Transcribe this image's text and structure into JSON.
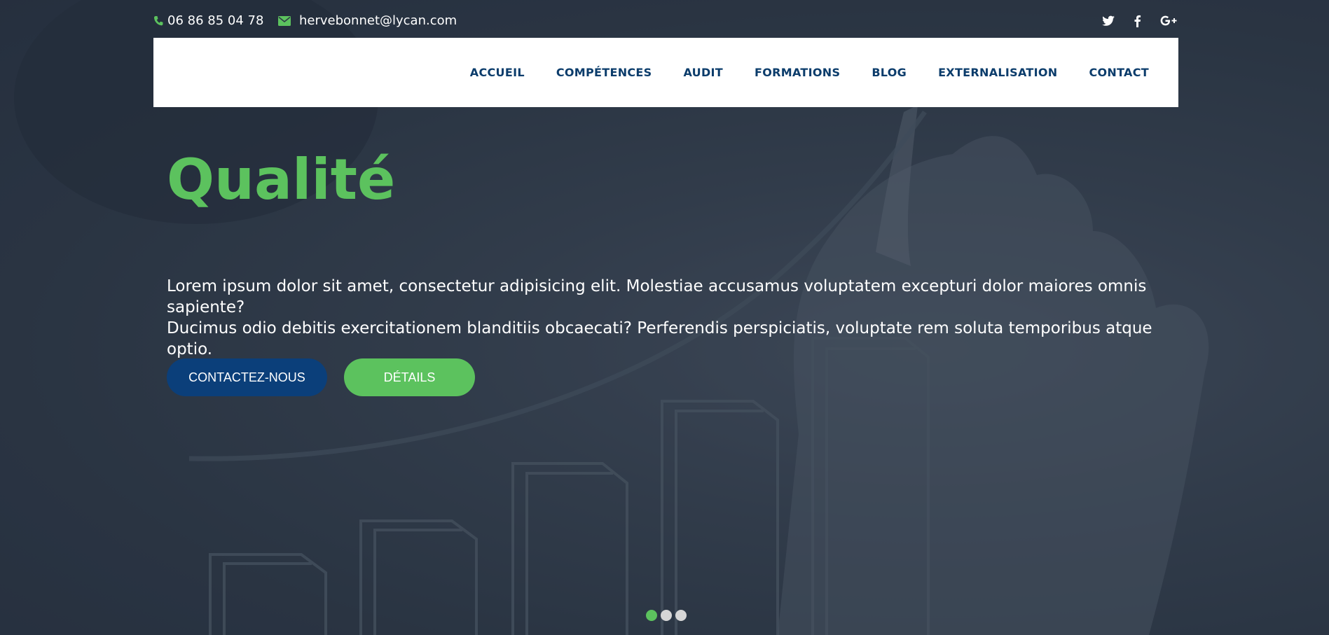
{
  "topbar": {
    "phone": "06 86 85 04 78",
    "email": "hervebonnet@lycan.com",
    "socials": [
      "twitter-icon",
      "facebook-icon",
      "google-plus-icon"
    ]
  },
  "nav": {
    "items": [
      "ACCUEIL",
      "COMPÉTENCES",
      "AUDIT",
      "FORMATIONS",
      "BLOG",
      "EXTERNALISATION",
      "CONTACT"
    ]
  },
  "hero": {
    "title": "Qualité",
    "text_line1": "Lorem ipsum dolor sit amet, consectetur adipisicing elit. Molestiae accusamus voluptatem excepturi dolor maiores omnis sapiente?",
    "text_line2": "Ducimus odio debitis exercitationem blanditiis obcaecati? Perferendis perspiciatis, voluptate rem soluta temporibus atque optio.",
    "btn_contact": "CONTACTEZ-NOUS",
    "btn_details": "DÉTAILS"
  },
  "slider": {
    "slide_count": 3,
    "active_index": 0
  },
  "colors": {
    "accent_green": "#5cc25e",
    "brand_blue": "#0b3f7a",
    "nav_text": "#0b3c6b"
  }
}
